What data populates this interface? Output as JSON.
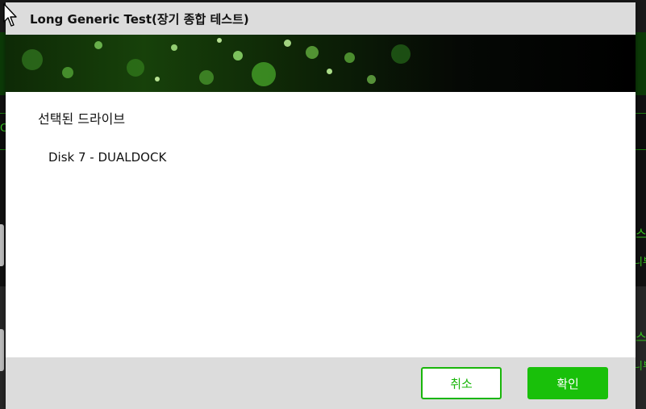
{
  "dialog": {
    "title": "Long Generic Test(장기 종합 테스트)",
    "selected_drive_label": "선택된 드라이브",
    "drive_name": "Disk 7 - DUALDOCK",
    "cancel_label": "취소",
    "ok_label": "확인"
  },
  "background": {
    "right_snippets": [
      "스",
      "니부",
      "스",
      "니부"
    ],
    "left_snippets": [
      "C"
    ]
  },
  "colors": {
    "accent": "#19c00a",
    "titlebar": "#dcdcdc",
    "footer": "#dcdcdc"
  },
  "icons": {
    "cursor": "mouse-pointer-icon"
  }
}
